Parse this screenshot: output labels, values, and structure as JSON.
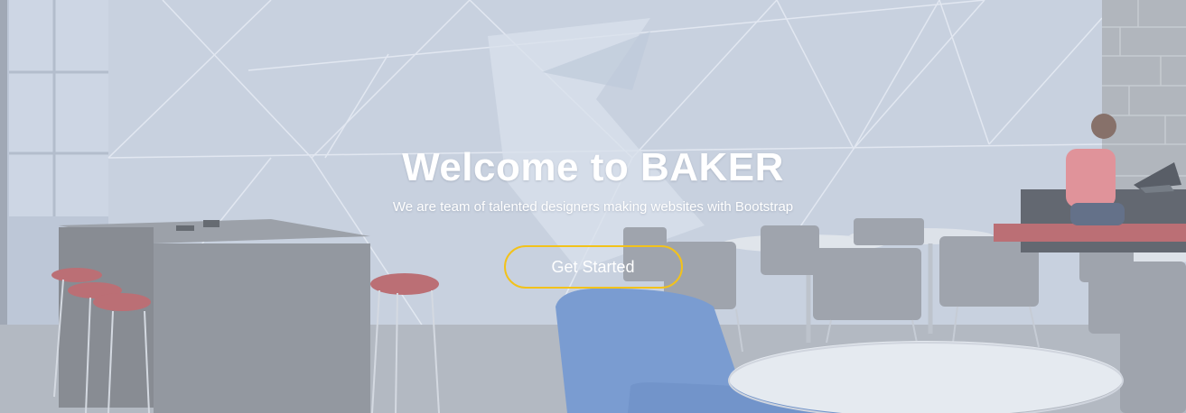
{
  "hero": {
    "title": "Welcome to BAKER",
    "subtitle": "We are team of talented designers making websites with Bootstrap",
    "cta_label": "Get Started"
  },
  "colors": {
    "cta_border": "#f2c21b",
    "text": "#ffffff",
    "wall": "#c4cedd",
    "chair_blue": "#5b86c9",
    "stool_red": "#b5474a"
  }
}
